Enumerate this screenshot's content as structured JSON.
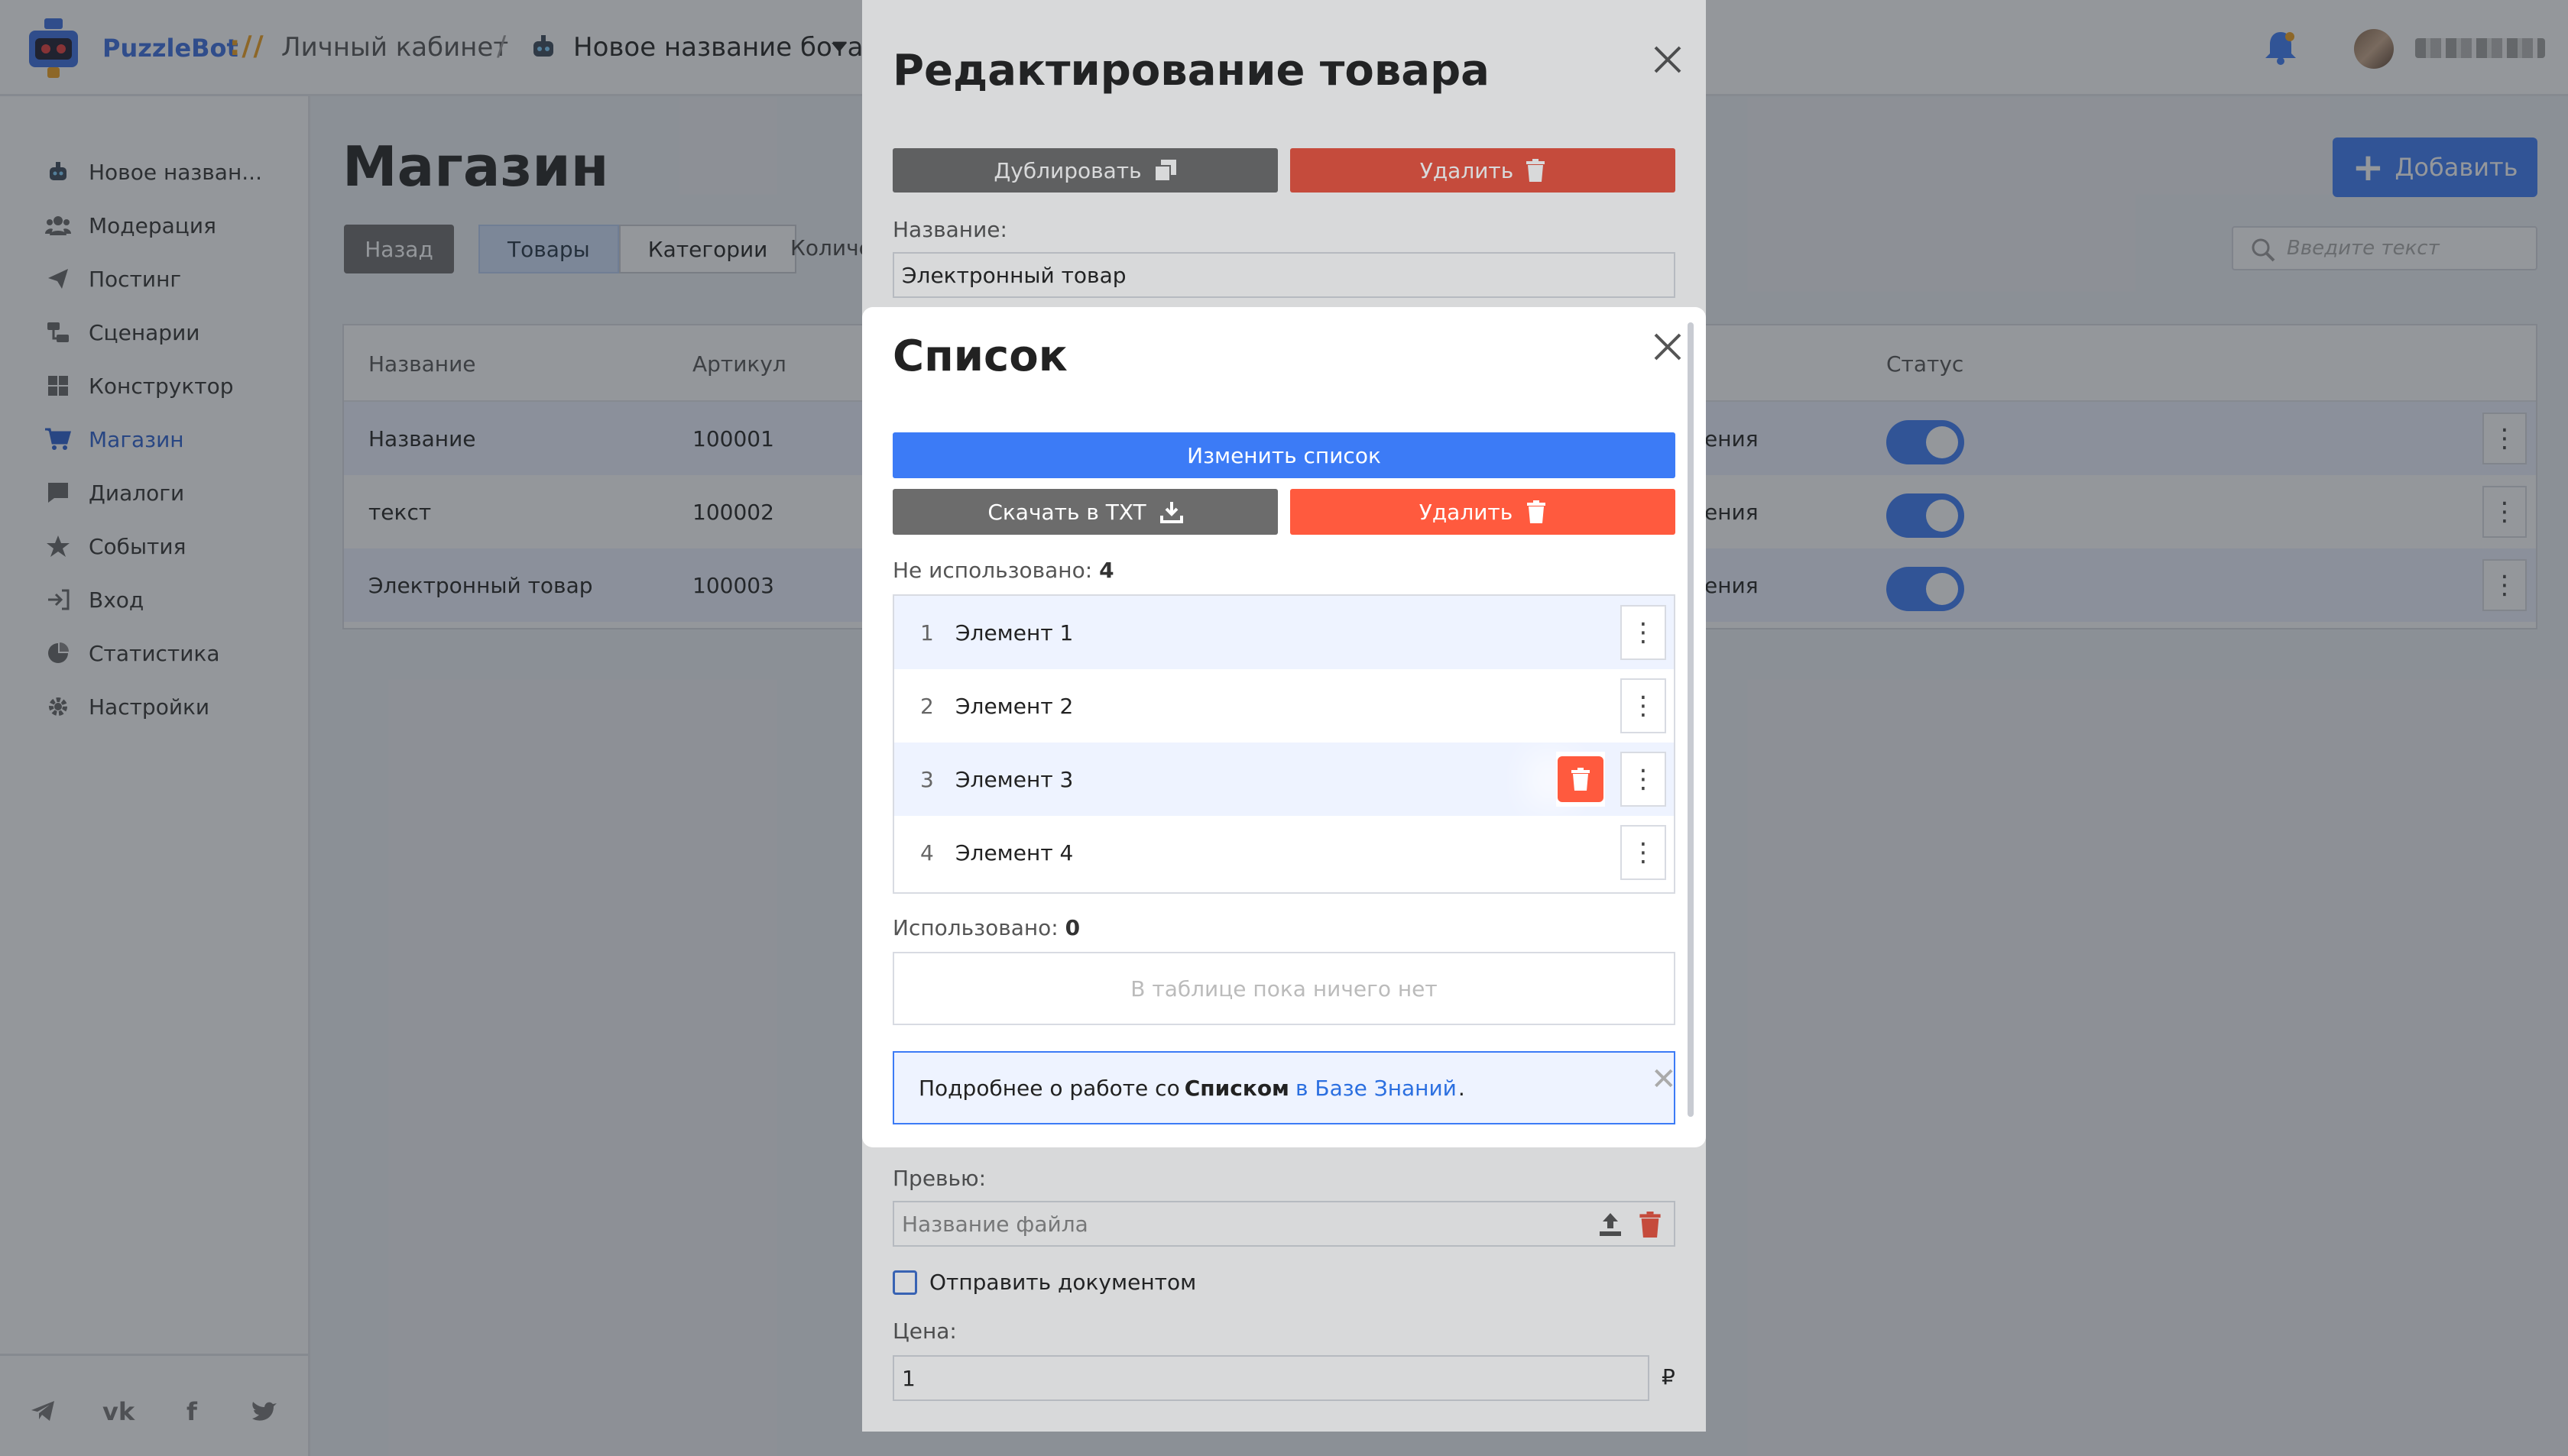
{
  "header": {
    "brand": "PuzzleBot",
    "brand_sep": "://",
    "cabinet": "Личный кабинет",
    "crumb_sep": "/",
    "bot_name": "Новое название бота"
  },
  "sidebar": {
    "items": [
      {
        "label": "Новое назван...",
        "icon": "bot-icon"
      },
      {
        "label": "Модерация",
        "icon": "users-icon"
      },
      {
        "label": "Постинг",
        "icon": "send-icon"
      },
      {
        "label": "Сценарии",
        "icon": "scenario-icon"
      },
      {
        "label": "Конструктор",
        "icon": "grid-icon"
      },
      {
        "label": "Магазин",
        "icon": "cart-icon"
      },
      {
        "label": "Диалоги",
        "icon": "chat-icon"
      },
      {
        "label": "События",
        "icon": "star-icon"
      },
      {
        "label": "Вход",
        "icon": "login-icon"
      },
      {
        "label": "Статистика",
        "icon": "pie-icon"
      },
      {
        "label": "Настройки",
        "icon": "gear-icon"
      }
    ],
    "active_index": 5
  },
  "main": {
    "title": "Магазин",
    "back_label": "Назад",
    "tabs": [
      "Товары",
      "Категории"
    ],
    "tab_more": "Количе",
    "add_label": "Добавить",
    "search_placeholder": "Введите текст",
    "table": {
      "headers": {
        "name": "Название",
        "sku": "Артикул",
        "status": "Статус"
      },
      "rows": [
        {
          "name": "Название",
          "sku": "100001",
          "partial": "ения"
        },
        {
          "name": "текст",
          "sku": "100002",
          "partial": "ения"
        },
        {
          "name": "Электронный товар",
          "sku": "100003",
          "partial": "ения"
        }
      ]
    }
  },
  "edit_modal": {
    "title": "Редактирование товара",
    "duplicate_label": "Дублировать",
    "delete_label": "Удалить",
    "name_label": "Название:",
    "name_value": "Электронный товар",
    "preview_label": "Превью:",
    "file_placeholder": "Название файла",
    "send_doc_label": "Отправить документом",
    "price_label": "Цена:",
    "price_value": "1",
    "currency": "₽"
  },
  "list_modal": {
    "title": "Список",
    "edit_list_label": "Изменить список",
    "download_label": "Скачать в TXT",
    "delete_label": "Удалить",
    "unused_label": "Не использовано:",
    "unused_count": "4",
    "items": [
      {
        "num": "1",
        "text": "Элемент 1"
      },
      {
        "num": "2",
        "text": "Элемент 2"
      },
      {
        "num": "3",
        "text": "Элемент 3"
      },
      {
        "num": "4",
        "text": "Элемент 4"
      }
    ],
    "used_label": "Использовано:",
    "used_count": "0",
    "empty_text": "В таблице пока ничего нет",
    "info_prefix": "Подробнее о работе со",
    "info_bold": "Списком",
    "info_link": "в Базе Знаний",
    "info_suffix": "."
  },
  "colors": {
    "accent": "#3c7bf6",
    "danger": "#ff5a3e",
    "neutral": "#6c6c6c"
  }
}
